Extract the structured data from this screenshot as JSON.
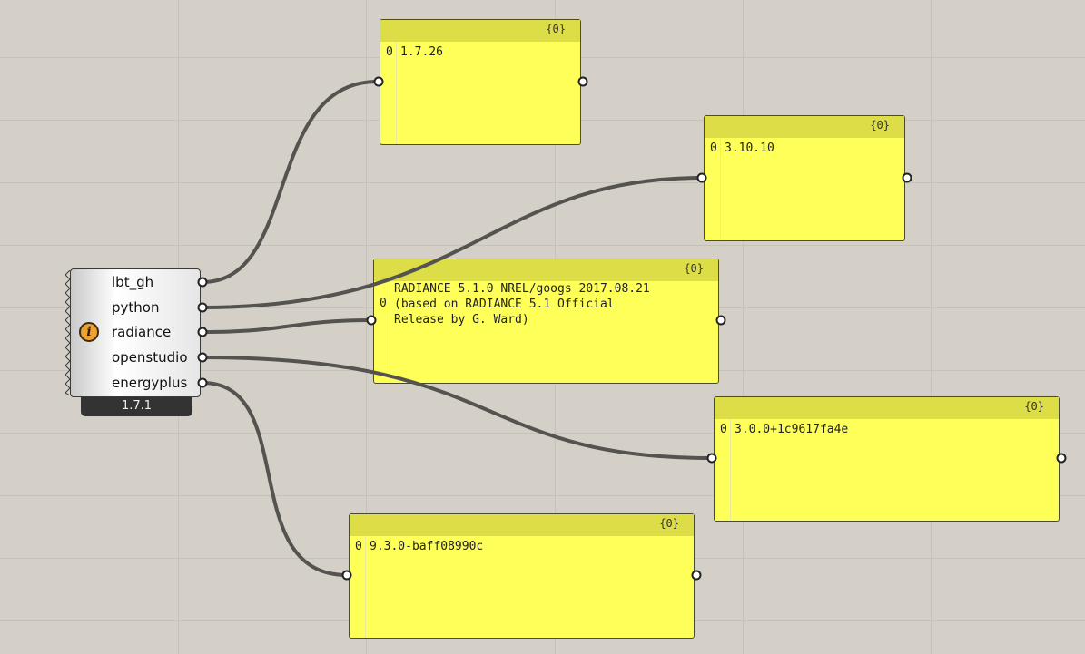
{
  "component": {
    "outputs": [
      "lbt_gh",
      "python",
      "radiance",
      "openstudio",
      "energyplus"
    ],
    "version": "1.7.1",
    "icon": "info-icon"
  },
  "panels": [
    {
      "count": "{0}",
      "index": "0",
      "text": "1.7.26"
    },
    {
      "count": "{0}",
      "index": "0",
      "text": "3.10.10"
    },
    {
      "count": "{0}",
      "index": "0",
      "text": "RADIANCE 5.1.0 NREL/googs 2017.08.21\n(based on RADIANCE 5.1 Official\nRelease by G. Ward)"
    },
    {
      "count": "{0}",
      "index": "0",
      "text": "3.0.0+1c9617fa4e"
    },
    {
      "count": "{0}",
      "index": "0",
      "text": "9.3.0-baff08990c"
    }
  ],
  "colors": {
    "canvas": "#d4d0c8",
    "panel": "#ffff5a",
    "panel_header": "#dddd48",
    "wire": "#555350",
    "info_icon": "#f0a030"
  }
}
